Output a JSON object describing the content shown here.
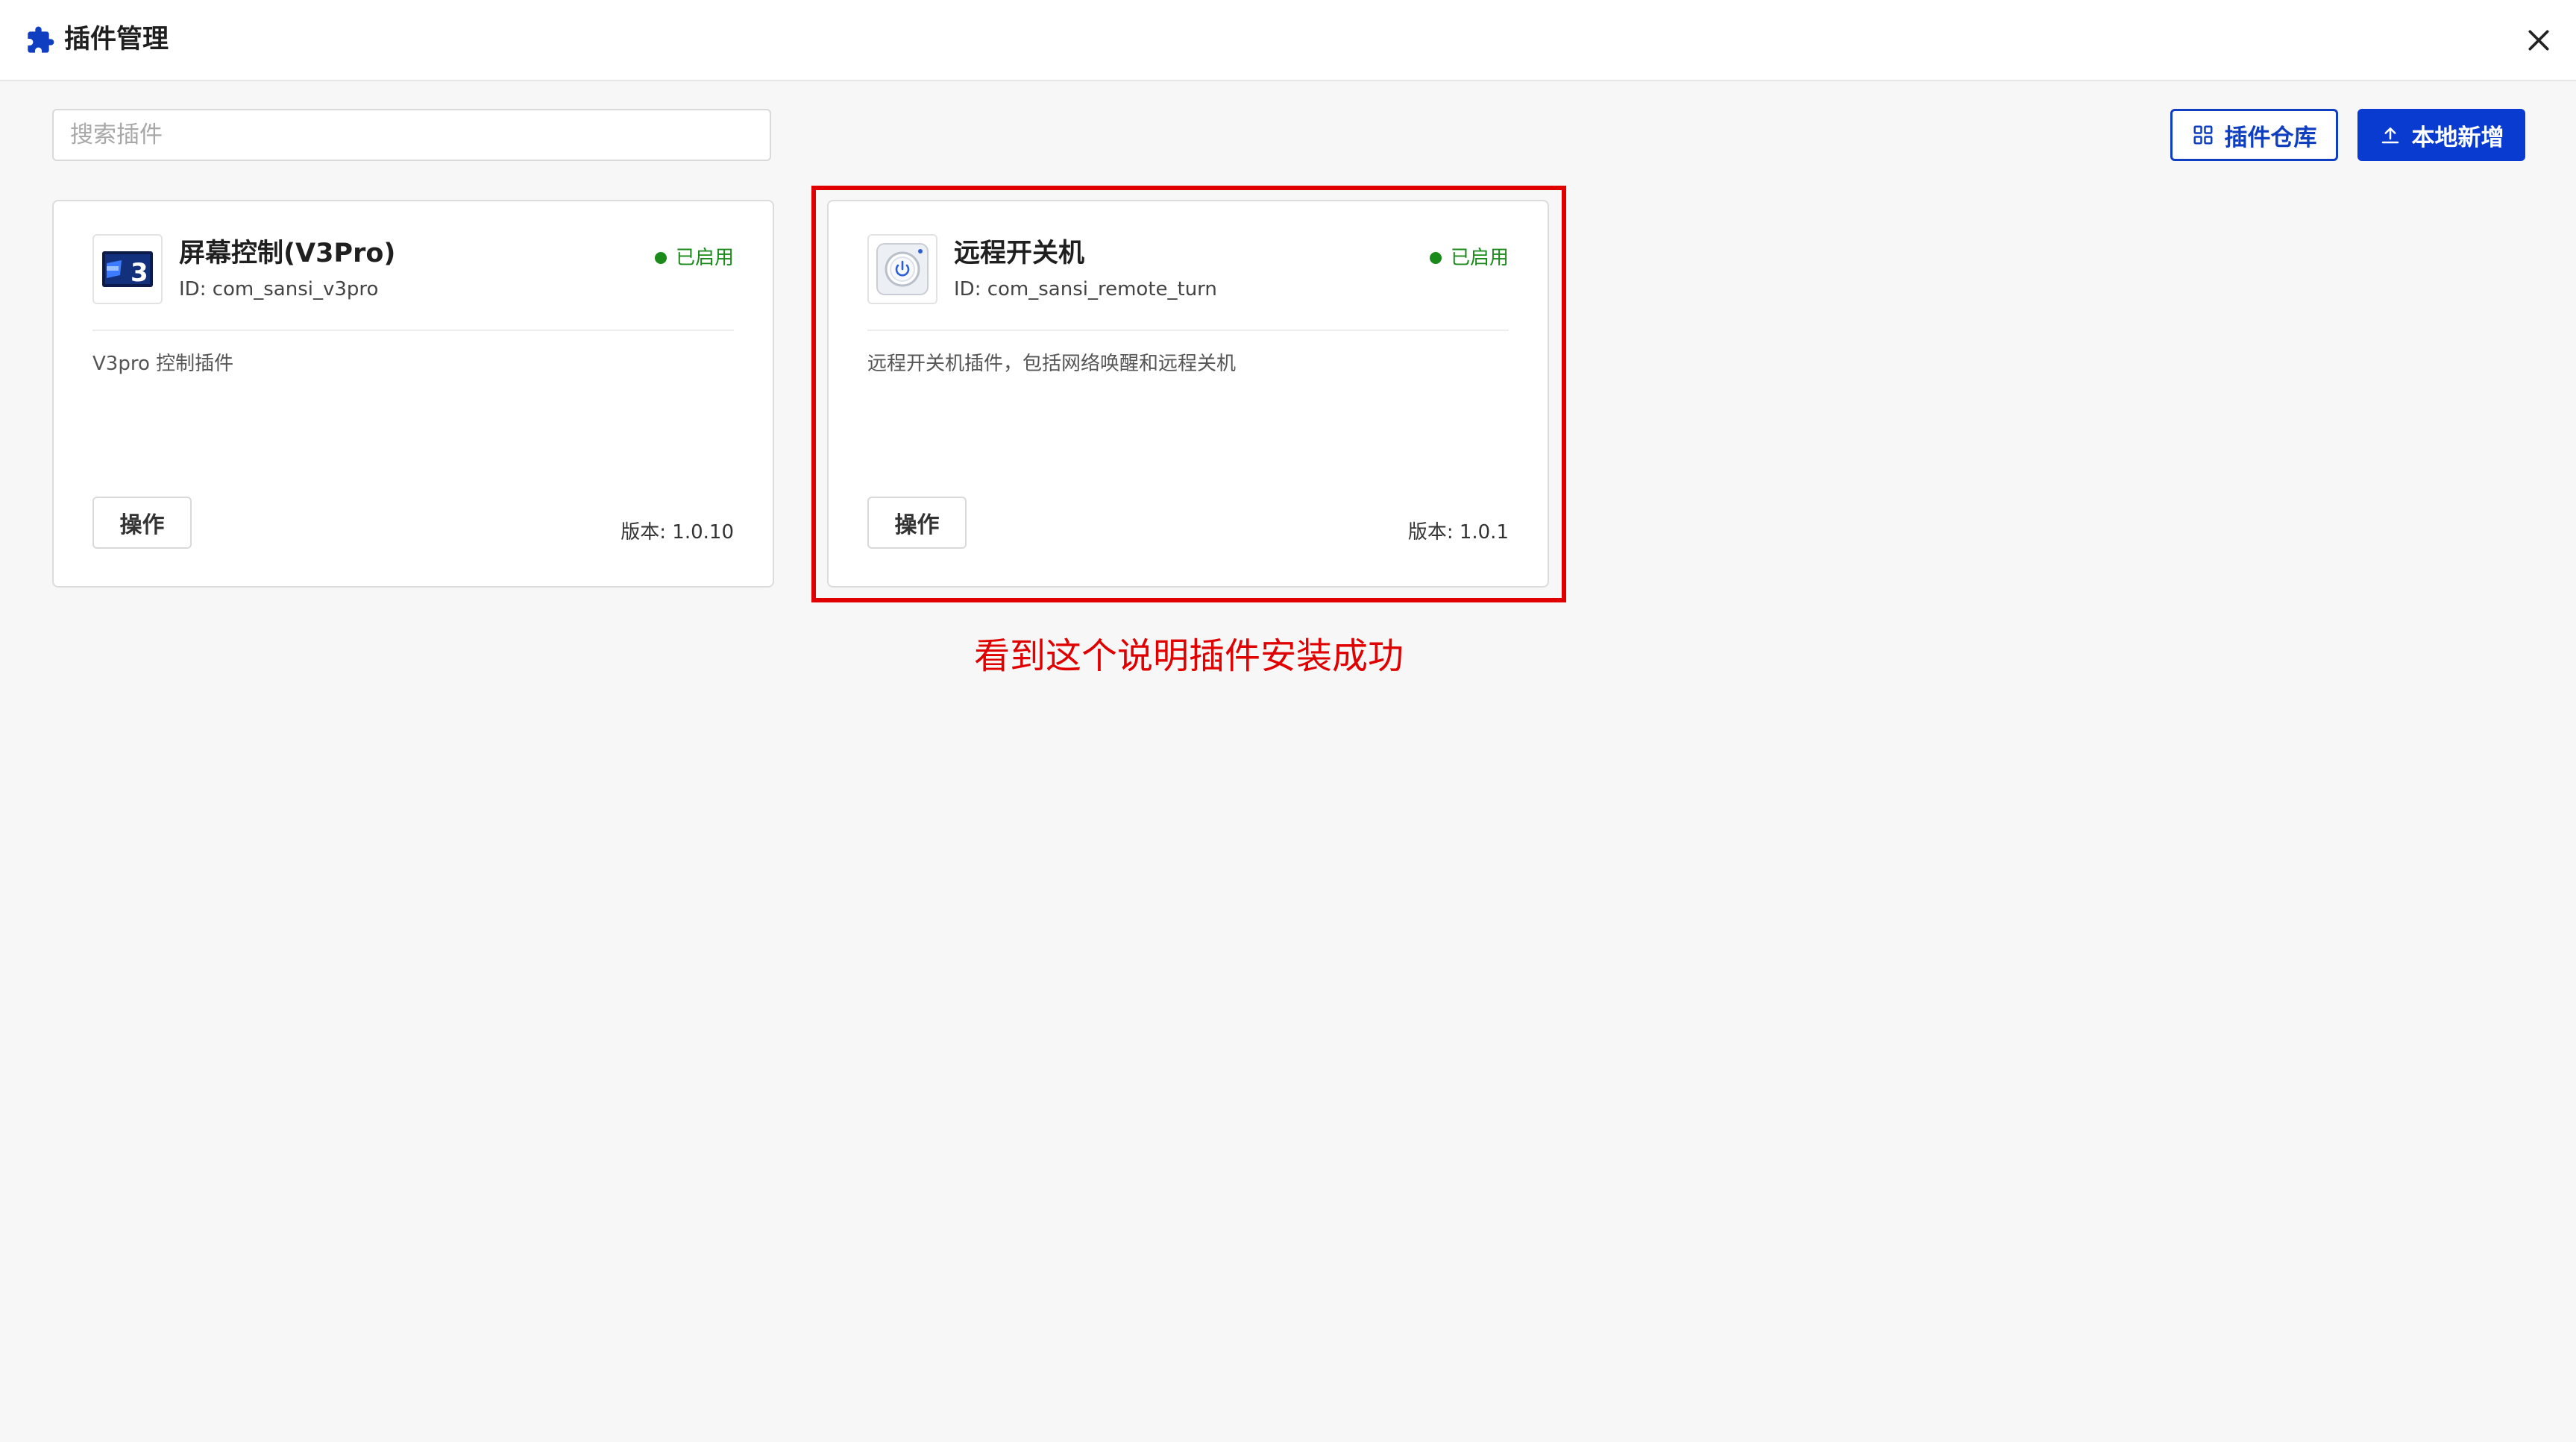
{
  "header": {
    "title": "插件管理",
    "icon": "puzzle-icon",
    "close_icon": "close-icon"
  },
  "toolbar": {
    "search_placeholder": "搜索插件",
    "search_value": "",
    "repo_button_label": "插件仓库",
    "repo_icon": "grid-icon",
    "local_add_label": "本地新增",
    "local_add_icon": "upload-icon"
  },
  "plugins": [
    {
      "name": "屏幕控制(V3Pro)",
      "id": "ID: com_sansi_v3pro",
      "status": "已启用",
      "description": "V3pro 控制插件",
      "action_label": "操作",
      "version": "版本: 1.0.10",
      "icon": "v3pro-logo-icon"
    },
    {
      "name": "远程开关机",
      "id": "ID: com_sansi_remote_turn",
      "status": "已启用",
      "description": "远程开关机插件，包括网络唤醒和远程关机",
      "action_label": "操作",
      "version": "版本: 1.0.1",
      "icon": "power-icon"
    }
  ],
  "annotation": {
    "text": "看到这个说明插件安装成功",
    "color": "#e00000"
  },
  "colors": {
    "accent": "#0a3bd1",
    "status_enabled": "#1a8a1a",
    "background": "#f7f7f7"
  }
}
